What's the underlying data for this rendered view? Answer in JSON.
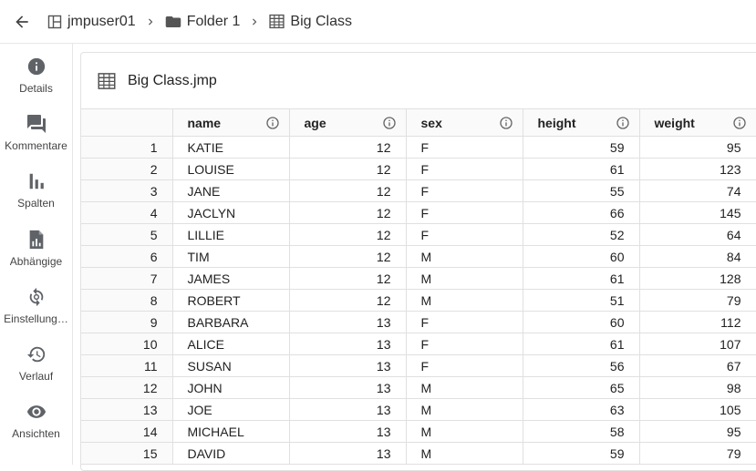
{
  "breadcrumb": {
    "items": [
      {
        "label": "jmpuser01",
        "icon": "workspace-icon"
      },
      {
        "label": "Folder 1",
        "icon": "folder-icon"
      },
      {
        "label": "Big Class",
        "icon": "table-icon"
      }
    ]
  },
  "rail": {
    "items": [
      {
        "label": "Details",
        "icon": "info-icon"
      },
      {
        "label": "Kommentare",
        "icon": "comment-icon"
      },
      {
        "label": "Spalten",
        "icon": "columns-icon"
      },
      {
        "label": "Abhängige",
        "icon": "dependents-icon"
      },
      {
        "label": "Einstellung…",
        "icon": "settings-sync-icon"
      },
      {
        "label": "Verlauf",
        "icon": "history-icon"
      },
      {
        "label": "Ansichten",
        "icon": "eye-icon"
      }
    ]
  },
  "panel": {
    "title": "Big Class.jmp"
  },
  "table": {
    "columns": [
      "name",
      "age",
      "sex",
      "height",
      "weight"
    ],
    "rows": [
      {
        "n": "1",
        "name": "KATIE",
        "age": "12",
        "sex": "F",
        "height": "59",
        "weight": "95"
      },
      {
        "n": "2",
        "name": "LOUISE",
        "age": "12",
        "sex": "F",
        "height": "61",
        "weight": "123"
      },
      {
        "n": "3",
        "name": "JANE",
        "age": "12",
        "sex": "F",
        "height": "55",
        "weight": "74"
      },
      {
        "n": "4",
        "name": "JACLYN",
        "age": "12",
        "sex": "F",
        "height": "66",
        "weight": "145"
      },
      {
        "n": "5",
        "name": "LILLIE",
        "age": "12",
        "sex": "F",
        "height": "52",
        "weight": "64"
      },
      {
        "n": "6",
        "name": "TIM",
        "age": "12",
        "sex": "M",
        "height": "60",
        "weight": "84"
      },
      {
        "n": "7",
        "name": "JAMES",
        "age": "12",
        "sex": "M",
        "height": "61",
        "weight": "128"
      },
      {
        "n": "8",
        "name": "ROBERT",
        "age": "12",
        "sex": "M",
        "height": "51",
        "weight": "79"
      },
      {
        "n": "9",
        "name": "BARBARA",
        "age": "13",
        "sex": "F",
        "height": "60",
        "weight": "112"
      },
      {
        "n": "10",
        "name": "ALICE",
        "age": "13",
        "sex": "F",
        "height": "61",
        "weight": "107"
      },
      {
        "n": "11",
        "name": "SUSAN",
        "age": "13",
        "sex": "F",
        "height": "56",
        "weight": "67"
      },
      {
        "n": "12",
        "name": "JOHN",
        "age": "13",
        "sex": "M",
        "height": "65",
        "weight": "98"
      },
      {
        "n": "13",
        "name": "JOE",
        "age": "13",
        "sex": "M",
        "height": "63",
        "weight": "105"
      },
      {
        "n": "14",
        "name": "MICHAEL",
        "age": "13",
        "sex": "M",
        "height": "58",
        "weight": "95"
      },
      {
        "n": "15",
        "name": "DAVID",
        "age": "13",
        "sex": "M",
        "height": "59",
        "weight": "79"
      }
    ]
  },
  "colors": {
    "icon": "#5f6368",
    "grid_line": "#e0e0e0"
  }
}
